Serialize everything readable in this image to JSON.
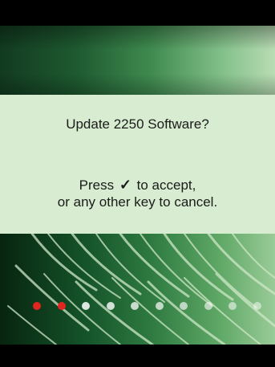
{
  "dialog": {
    "title": "Update 2250 Software?",
    "accept_prefix": "Press",
    "check_glyph": "✓",
    "accept_suffix": "to accept,",
    "cancel_line": "or any other key to cancel."
  },
  "progress": {
    "total_steps": 10,
    "completed_steps": 2,
    "completed_color": "#e0261f",
    "pending_color": "#ffffff"
  },
  "colors": {
    "panel_background": "#d7ecd0",
    "text": "#1b1b1b"
  }
}
